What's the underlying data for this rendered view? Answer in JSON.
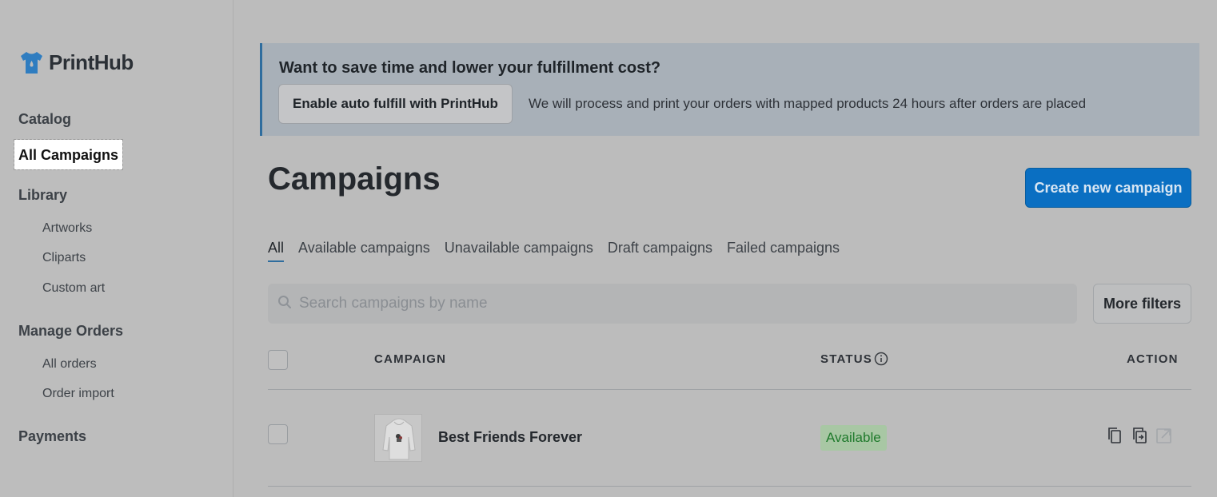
{
  "brand": {
    "name": "PrintHub",
    "color": "#2f7dc0"
  },
  "sidebar": {
    "catalog": "Catalog",
    "all_campaigns": "All Campaigns",
    "library": "Library",
    "library_items": [
      "Artworks",
      "Cliparts",
      "Custom art"
    ],
    "manage_orders": "Manage Orders",
    "order_items": [
      "All orders",
      "Order import"
    ],
    "payments": "Payments"
  },
  "banner": {
    "title": "Want to save time and lower your fulfillment cost?",
    "button": "Enable auto fulfill with PrintHub",
    "text": "We will process and print your orders with mapped products 24 hours after orders are placed"
  },
  "page": {
    "title": "Campaigns",
    "create_button": "Create new campaign"
  },
  "tabs": [
    "All",
    "Available campaigns",
    "Unavailable campaigns",
    "Draft campaigns",
    "Failed campaigns"
  ],
  "search": {
    "placeholder": "Search campaigns by name"
  },
  "filters_button": "More filters",
  "table": {
    "columns": {
      "campaign": "CAMPAIGN",
      "status": "STATUS",
      "action": "ACTION"
    },
    "rows": [
      {
        "name": "Best Friends Forever",
        "status": "Available"
      }
    ]
  },
  "icons": [
    "tshirt-logo-icon",
    "search-icon",
    "info-icon",
    "duplicate-icon",
    "copy-icon",
    "external-link-icon"
  ],
  "colors": {
    "accent": "#0a6fc2",
    "status_available": "#1f7a2c"
  }
}
